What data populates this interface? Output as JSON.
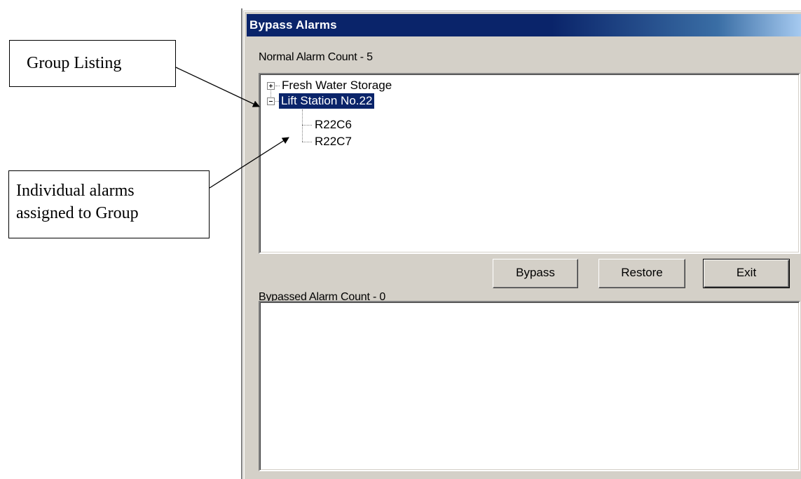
{
  "annotations": {
    "group_listing": "Group Listing",
    "individual_line1": "Individual alarms",
    "individual_line2": "assigned to Group"
  },
  "dialog": {
    "title": "Bypass Alarms",
    "normal_count_label": "Normal Alarm Count - 5",
    "bypassed_count_label": "Bypassed Alarm Count - 0",
    "tree": [
      {
        "label": "Fresh Water Storage",
        "expanded": false,
        "selected": false,
        "children": []
      },
      {
        "label": "Lift Station No.22",
        "expanded": true,
        "selected": true,
        "children": [
          {
            "label": "R22C6"
          },
          {
            "label": "R22C7"
          }
        ]
      }
    ],
    "buttons": {
      "bypass": "Bypass",
      "restore": "Restore",
      "exit": "Exit"
    },
    "colors": {
      "titlebar": "#0a246a",
      "selection": "#0a246a",
      "face": "#d4d0c8"
    }
  }
}
